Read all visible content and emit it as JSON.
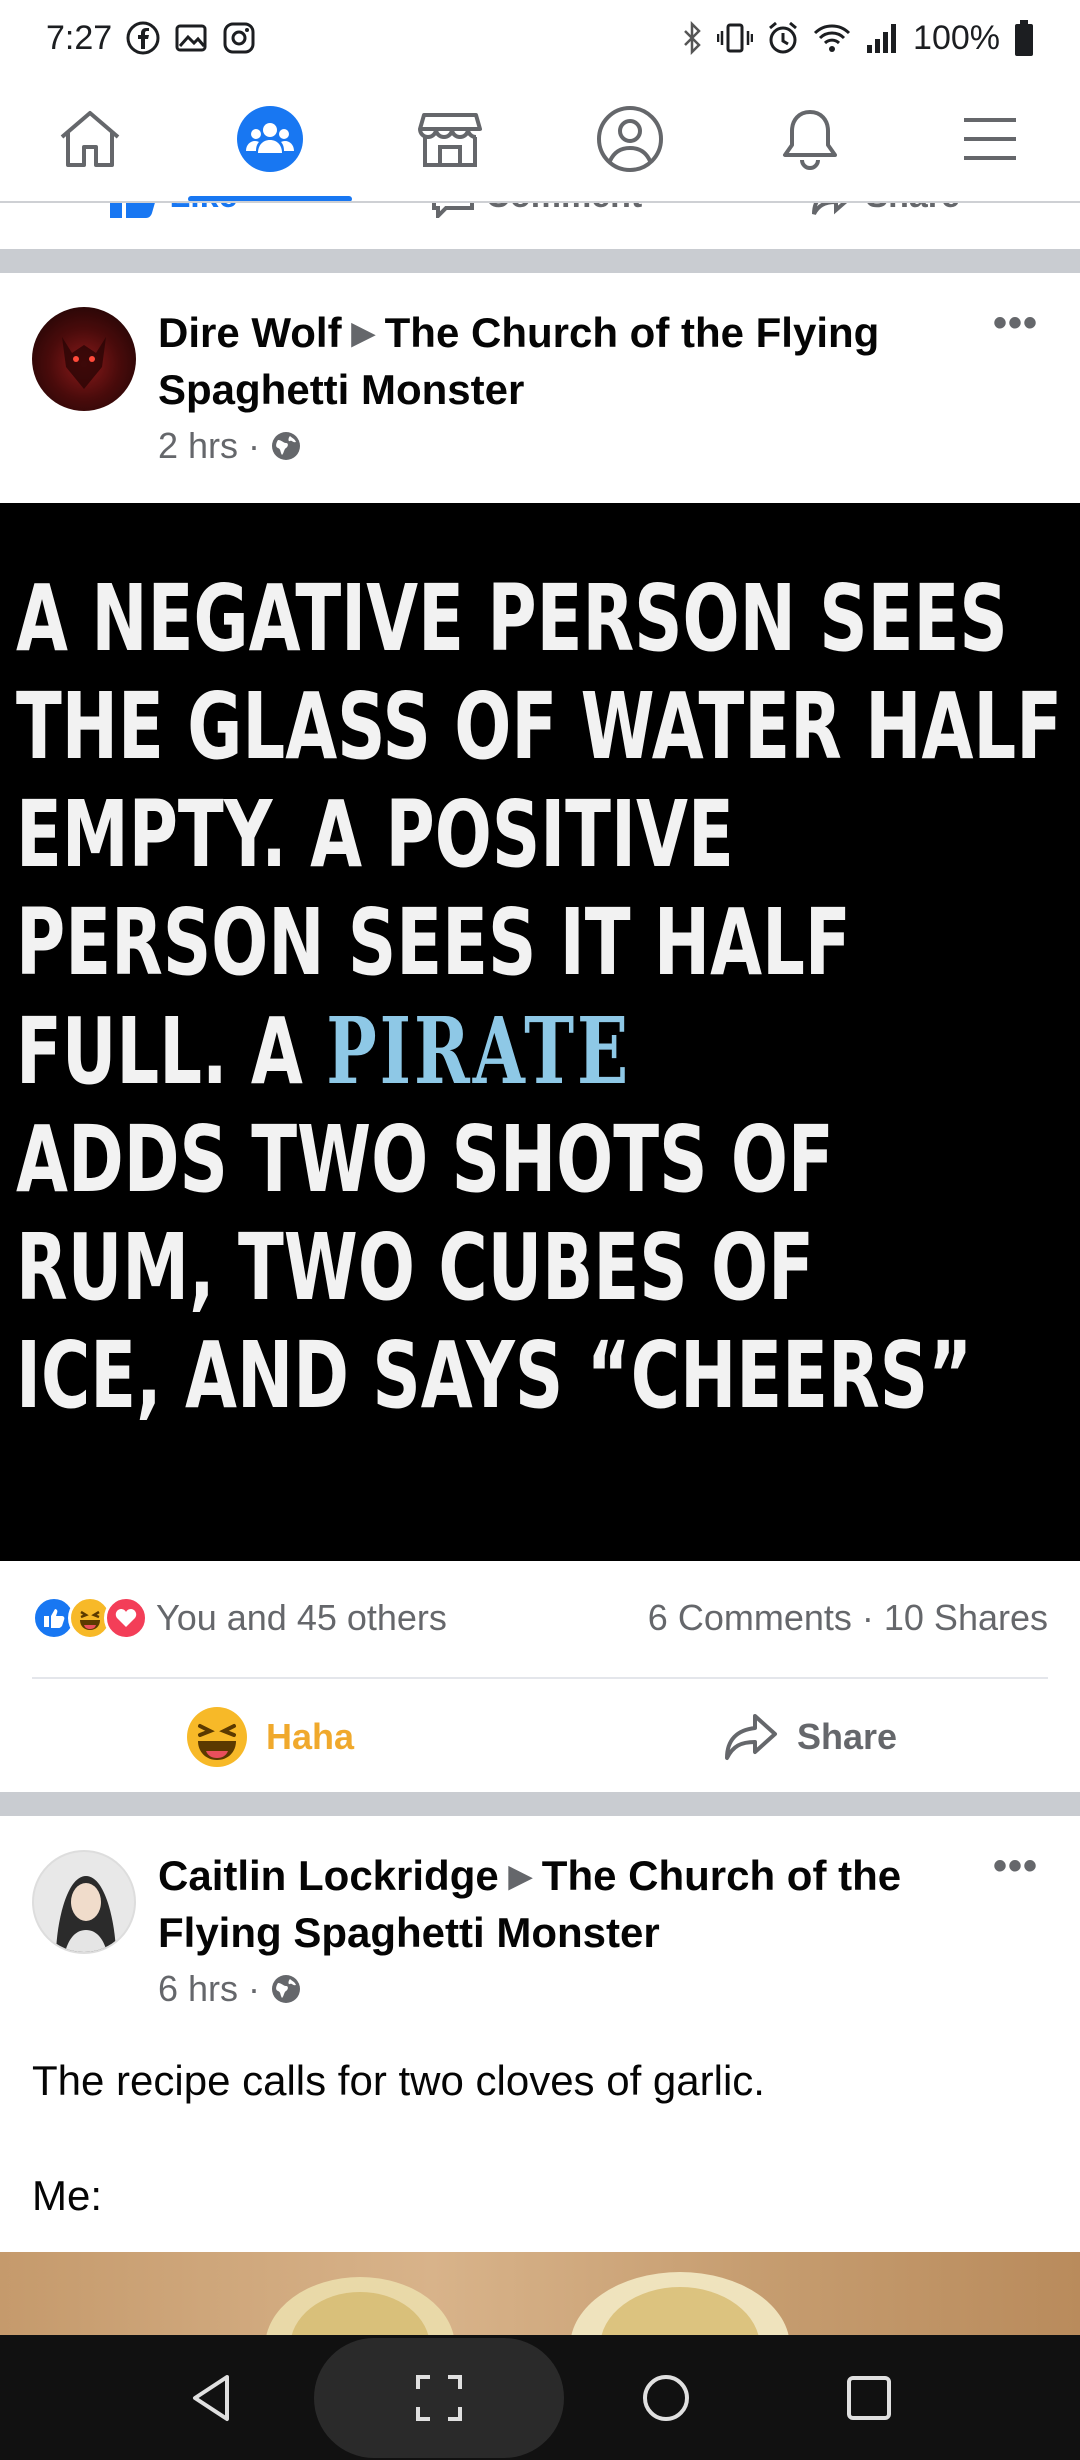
{
  "status_bar": {
    "time": "7:27",
    "battery": "100%",
    "left_icons": [
      "facebook-icon",
      "gallery-icon",
      "instagram-icon"
    ],
    "right_icons": [
      "bluetooth-icon",
      "vibrate-icon",
      "alarm-icon",
      "wifi-icon",
      "signal-icon",
      "battery-icon"
    ]
  },
  "nav_tabs": [
    {
      "icon": "home-icon",
      "active": false
    },
    {
      "icon": "groups-icon",
      "active": true
    },
    {
      "icon": "marketplace-icon",
      "active": false
    },
    {
      "icon": "profile-icon",
      "active": false
    },
    {
      "icon": "notifications-icon",
      "active": false
    },
    {
      "icon": "menu-icon",
      "active": false
    }
  ],
  "previous_post_actions": [
    "Like",
    "Comment",
    "Share"
  ],
  "posts": [
    {
      "author": "Dire Wolf",
      "group": "The Church of the Flying Spaghetti Monster",
      "time": "2 hrs",
      "privacy_icon": "globe-icon",
      "image_text_lines": [
        "A NEGATIVE PERSON SEES",
        "THE GLASS OF WATER HALF",
        "EMPTY.  A POSITIVE",
        "PERSON SEES IT HALF",
        "FULL.  A",
        "ADDS TWO SHOTS OF",
        "RUM, TWO CUBES OF",
        "ICE, AND SAYS “CHEERS”"
      ],
      "image_highlight_word": "PIRATE",
      "reactions_summary": "You and 45 others",
      "comments": "6 Comments",
      "shares": "10 Shares",
      "actions": {
        "reaction": "Haha",
        "share": "Share"
      }
    },
    {
      "author": "Caitlin Lockridge",
      "group": "The Church of the Flying Spaghetti Monster",
      "time": "6 hrs",
      "privacy_icon": "globe-icon",
      "text_line_1": "The recipe calls for two cloves of garlic.",
      "text_line_2": "Me:"
    }
  ],
  "colors": {
    "brand_blue": "#1877f2",
    "haha_yellow": "#f0a92c",
    "secondary_text": "#65676b",
    "pirate_text": "#8ec8e6"
  }
}
